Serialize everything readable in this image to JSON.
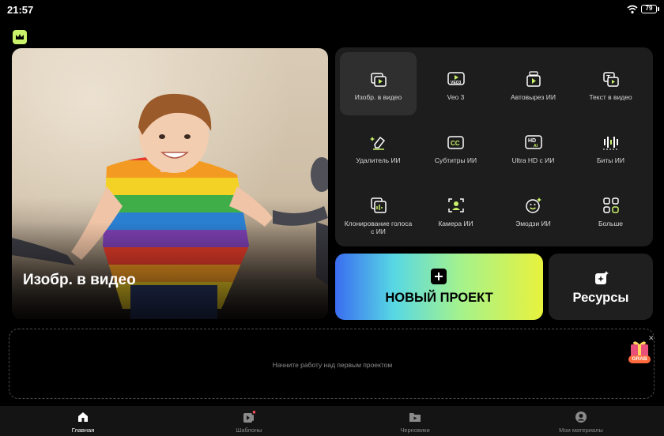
{
  "status": {
    "time": "21:57",
    "battery": "79"
  },
  "hero": {
    "title": "Изобр. в видео"
  },
  "tools": [
    {
      "label": "Изобр. в видео",
      "icon": "image-to-video-icon",
      "active": true
    },
    {
      "label": "Veo 3",
      "icon": "veo3-icon",
      "active": false
    },
    {
      "label": "Автовырез ИИ",
      "icon": "auto-cut-icon",
      "active": false
    },
    {
      "label": "Текст в видео",
      "icon": "text-to-video-icon",
      "active": false
    },
    {
      "label": "Удалитель ИИ",
      "icon": "eraser-icon",
      "active": false
    },
    {
      "label": "Субтитры ИИ",
      "icon": "captions-icon",
      "active": false
    },
    {
      "label": "Ultra HD с ИИ",
      "icon": "hd-icon",
      "active": false
    },
    {
      "label": "Биты ИИ",
      "icon": "beats-icon",
      "active": false
    },
    {
      "label": "Клонирование голоса с ИИ",
      "icon": "voice-clone-icon",
      "active": false
    },
    {
      "label": "Камера ИИ",
      "icon": "camera-icon",
      "active": false
    },
    {
      "label": "Эмодзи ИИ",
      "icon": "emoji-icon",
      "active": false
    },
    {
      "label": "Больше",
      "icon": "grid-icon",
      "active": false
    }
  ],
  "new_project": {
    "label": "НОВЫЙ ПРОЕКТ"
  },
  "resources": {
    "label": "Ресурсы"
  },
  "empty_state": {
    "text": "Начните работу над первым проектом",
    "badge": "GRAB"
  },
  "nav": [
    {
      "label": "Главная",
      "icon": "home-icon",
      "active": true
    },
    {
      "label": "Шаблоны",
      "icon": "templates-icon",
      "active": false
    },
    {
      "label": "Черновики",
      "icon": "drafts-icon",
      "active": false
    },
    {
      "label": "Мои материалы",
      "icon": "profile-icon",
      "active": false
    }
  ],
  "colors": {
    "accent": "#c9f26a",
    "panel": "#1d1d1d"
  }
}
